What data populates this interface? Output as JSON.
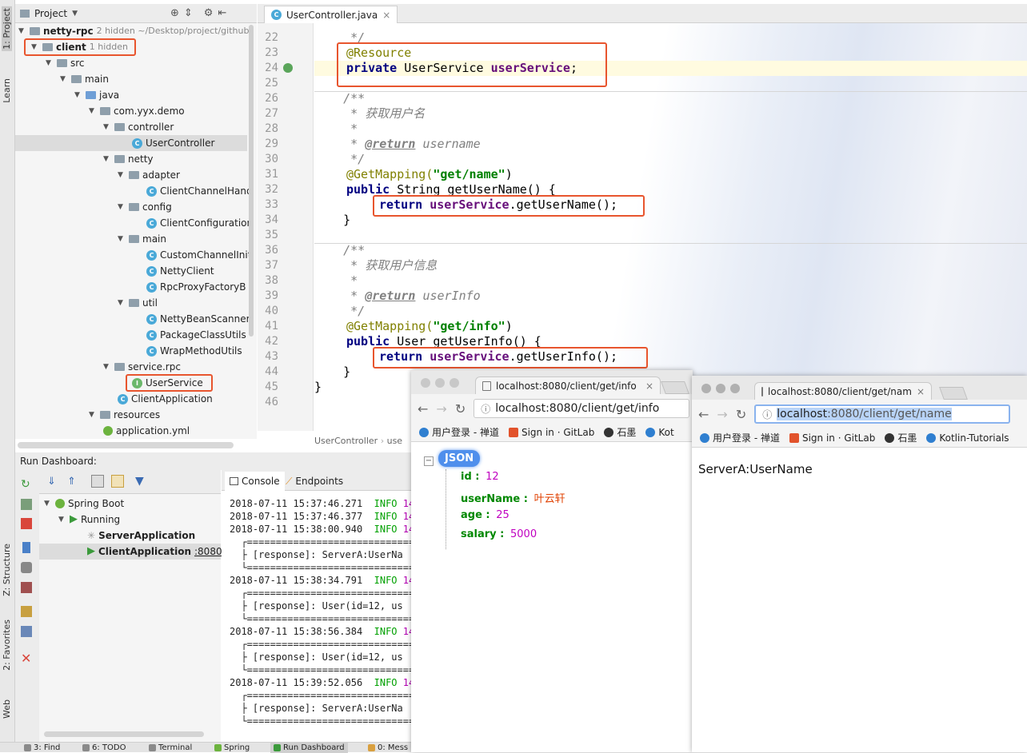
{
  "sidebar_left": {
    "project_tab": "1: Project",
    "learn_tab": "Learn",
    "structure_tab": "Z: Structure",
    "favorites_tab": "2: Favorites",
    "web_tab": "Web"
  },
  "project_panel": {
    "title": "Project",
    "tree": [
      {
        "label": "netty-rpc",
        "hint": "2 hidden  ~/Desktop/project/github"
      },
      {
        "label": "client",
        "hint": "1 hidden"
      },
      {
        "label": "src"
      },
      {
        "label": "main"
      },
      {
        "label": "java"
      },
      {
        "label": "com.yyx.demo"
      },
      {
        "label": "controller"
      },
      {
        "label": "UserController"
      },
      {
        "label": "netty"
      },
      {
        "label": "adapter"
      },
      {
        "label": "ClientChannelHand"
      },
      {
        "label": "config"
      },
      {
        "label": "ClientConfiguration"
      },
      {
        "label": "main"
      },
      {
        "label": "CustomChannelInit"
      },
      {
        "label": "NettyClient"
      },
      {
        "label": "RpcProxyFactoryB"
      },
      {
        "label": "util"
      },
      {
        "label": "NettyBeanScanner"
      },
      {
        "label": "PackageClassUtils"
      },
      {
        "label": "WrapMethodUtils"
      },
      {
        "label": "service.rpc"
      },
      {
        "label": "UserService"
      },
      {
        "label": "ClientApplication"
      },
      {
        "label": "resources"
      },
      {
        "label": "application.yml"
      }
    ]
  },
  "editor": {
    "tab": "UserController.java",
    "breadcrumb": [
      "UserController",
      "use"
    ],
    "line_numbers": [
      "22",
      "23",
      "24",
      "25",
      "26",
      "27",
      "28",
      "29",
      "30",
      "31",
      "32",
      "33",
      "34",
      "35",
      "36",
      "37",
      "38",
      "39",
      "40",
      "41",
      "42",
      "43",
      "44",
      "45",
      "46"
    ],
    "code": {
      "l22": "     */",
      "l23_annotation": "@Resource",
      "l24_private": "private",
      "l24_type": "UserService",
      "l24_field": "userService",
      "l24_end": ";",
      "l26": "    /**",
      "l27": "     * 获取用户名",
      "l28": "     *",
      "l29_star": "     * ",
      "l29_tag": "@return",
      "l29_rest": " username",
      "l30": "     */",
      "l31_annotation": "@GetMapping(",
      "l31_str": "\"get/name\"",
      "l31_end": ")",
      "l32_public": "public",
      "l32_rest": " String getUserName() {",
      "l33_return": "return",
      "l33_field": "userService",
      "l33_rest": ".getUserName();",
      "l34": "    }",
      "l36": "    /**",
      "l37": "     * 获取用户信息",
      "l38": "     *",
      "l39_star": "     * ",
      "l39_tag": "@return",
      "l39_rest": " userInfo",
      "l40": "     */",
      "l41_annotation": "@GetMapping(",
      "l41_str": "\"get/info\"",
      "l41_end": ")",
      "l42_public": "public",
      "l42_rest": " User getUserInfo() {",
      "l43_return": "return",
      "l43_field": "userService",
      "l43_rest": ".getUserInfo();",
      "l44": "    }",
      "l45": "}"
    }
  },
  "run_dashboard": {
    "title": "Run Dashboard:",
    "tree": [
      {
        "label": "Spring Boot"
      },
      {
        "label": "Running"
      },
      {
        "label": "ServerApplication"
      },
      {
        "label": "ClientApplication",
        "port": ":8080/"
      }
    ],
    "console_tab": "Console",
    "endpoints_tab": "Endpoints",
    "logs": [
      {
        "ts": "2018-07-11 15:37:46.271",
        "level": "INFO",
        "pid": "14"
      },
      {
        "ts": "2018-07-11 15:37:46.377",
        "level": "INFO",
        "pid": "14"
      },
      {
        "ts": "2018-07-11 15:38:00.940",
        "level": "INFO",
        "pid": "14"
      },
      {
        "line": "  ┌================================="
      },
      {
        "line": "  ├ [response]: ServerA:UserNa"
      },
      {
        "line": "  └================================="
      },
      {
        "ts": "2018-07-11 15:38:34.791",
        "level": "INFO",
        "pid": "14"
      },
      {
        "line": "  ┌================================="
      },
      {
        "line": "  ├ [response]: User(id=12, us"
      },
      {
        "line": "  └================================="
      },
      {
        "ts": "2018-07-11 15:38:56.384",
        "level": "INFO",
        "pid": "14"
      },
      {
        "line": "  ┌================================="
      },
      {
        "line": "  ├ [response]: User(id=12, us"
      },
      {
        "line": "  └================================="
      },
      {
        "ts": "2018-07-11 15:39:52.056",
        "level": "INFO",
        "pid": "14"
      },
      {
        "line": "  ┌================================="
      },
      {
        "line": "  ├ [response]: ServerA:UserNa"
      },
      {
        "line": "  └================================="
      }
    ]
  },
  "bottom_bar": {
    "find": "3: Find",
    "todo": "6: TODO",
    "terminal": "Terminal",
    "spring": "Spring",
    "run_dashboard": "Run Dashboard",
    "messages": "0: Mess"
  },
  "browser_info": {
    "tab_title": "localhost:8080/client/get/info",
    "url": "localhost:8080/client/get/info",
    "bookmarks": [
      "用户登录 - 禅道",
      "Sign in · GitLab",
      "石墨",
      "Kot"
    ],
    "json_badge": "JSON",
    "json": [
      {
        "key": "id :",
        "value": "12",
        "kind": "num"
      },
      {
        "key": "userName :",
        "value": "叶云轩",
        "kind": "str"
      },
      {
        "key": "age :",
        "value": "25",
        "kind": "num"
      },
      {
        "key": "salary :",
        "value": "5000",
        "kind": "num"
      }
    ],
    "collapse_toggle": "−"
  },
  "browser_name": {
    "tab_title": "localhost:8080/client/get/nam",
    "url_host": "localhost",
    "url_path": ":8080/client/get/name",
    "bookmarks": [
      "用户登录 - 禅道",
      "Sign in · GitLab",
      "石墨",
      "Kotlin-Tutorials"
    ],
    "body": "ServerA:UserName"
  },
  "colors": {
    "highlight_box": "#e8552e",
    "keyword": "#000080",
    "annotation": "#808000",
    "string": "#008000",
    "field": "#660e7a",
    "info": "#00a000"
  }
}
